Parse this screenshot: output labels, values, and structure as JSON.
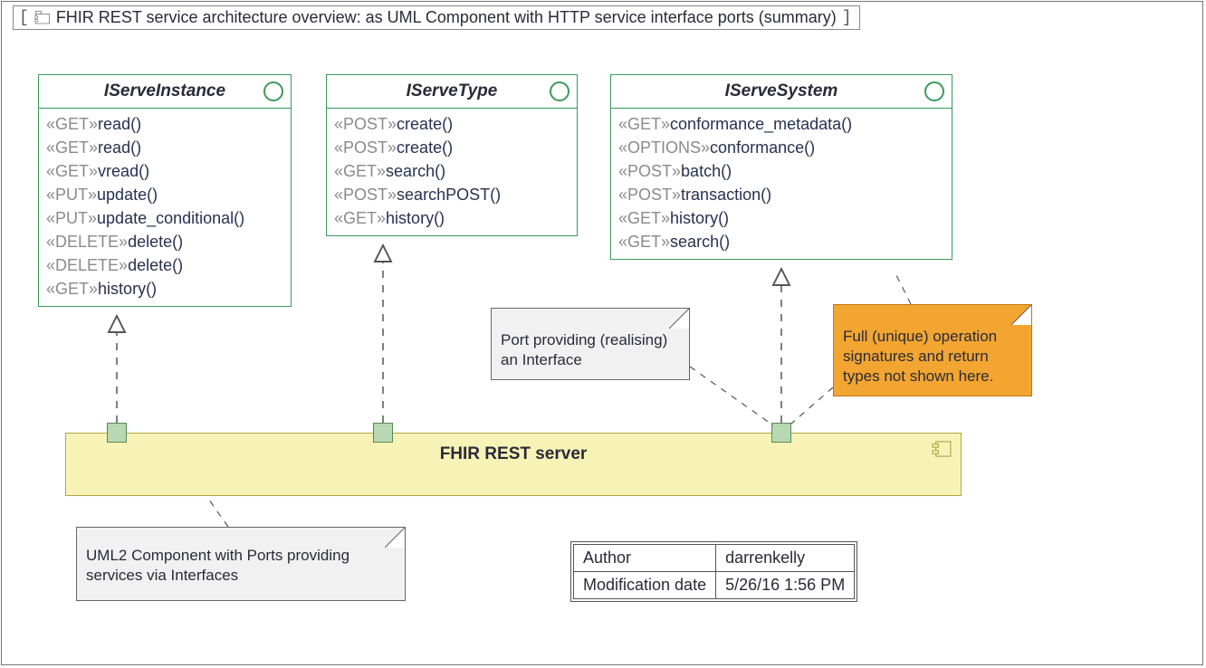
{
  "frame": {
    "title": "FHIR REST service architecture overview: as UML Component with HTTP service interface ports (summary)"
  },
  "interfaces": {
    "instance": {
      "name": "IServeInstance",
      "ops": [
        {
          "verb": "GET",
          "name": "read()"
        },
        {
          "verb": "GET",
          "name": "read()"
        },
        {
          "verb": "GET",
          "name": "vread()"
        },
        {
          "verb": "PUT",
          "name": "update()"
        },
        {
          "verb": "PUT",
          "name": "update_conditional()"
        },
        {
          "verb": "DELETE",
          "name": "delete()"
        },
        {
          "verb": "DELETE",
          "name": "delete()"
        },
        {
          "verb": "GET",
          "name": "history()"
        }
      ]
    },
    "type": {
      "name": "IServeType",
      "ops": [
        {
          "verb": "POST",
          "name": "create()"
        },
        {
          "verb": "POST",
          "name": "create()"
        },
        {
          "verb": "GET",
          "name": "search()"
        },
        {
          "verb": "POST",
          "name": "searchPOST()"
        },
        {
          "verb": "GET",
          "name": "history()"
        }
      ]
    },
    "system": {
      "name": "IServeSystem",
      "ops": [
        {
          "verb": "GET",
          "name": "conformance_metadata()"
        },
        {
          "verb": "OPTIONS",
          "name": "conformance()"
        },
        {
          "verb": "POST",
          "name": "batch()"
        },
        {
          "verb": "POST",
          "name": "transaction()"
        },
        {
          "verb": "GET",
          "name": "history()"
        },
        {
          "verb": "GET",
          "name": "search()"
        }
      ]
    }
  },
  "component": {
    "name": "FHIR REST server"
  },
  "notes": {
    "port": "Port providing (realising) an Interface",
    "signatures": "Full (unique) operation signatures and return types not shown here.",
    "uml2": "UML2 Component with Ports providing services via Interfaces"
  },
  "meta": {
    "author_label": "Author",
    "author_value": "darrenkelly",
    "moddate_label": "Modification date",
    "moddate_value": "5/26/16 1:56 PM"
  }
}
